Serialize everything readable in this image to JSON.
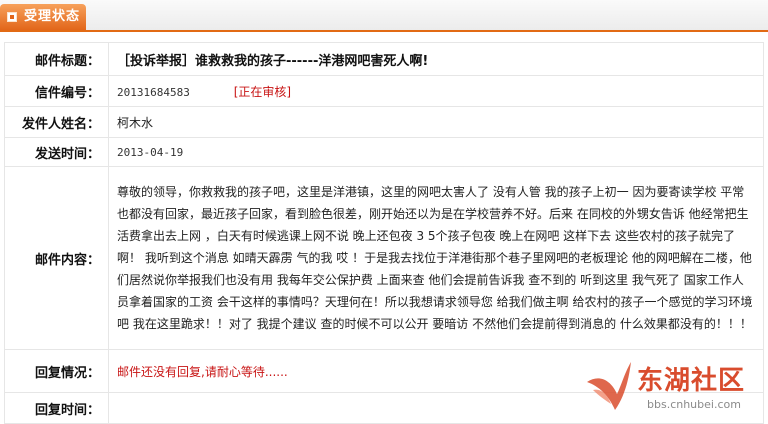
{
  "tab": {
    "label": "受理状态"
  },
  "fields": {
    "title_label": "邮件标题：",
    "title_value": "［投诉举报］谁救救我的孩子------洋港网吧害死人啊!",
    "id_label": "信件编号：",
    "id_value": "20131684583",
    "status": "[正在审核]",
    "sender_label": "发件人姓名：",
    "sender_value": "柯木水",
    "time_label": "发送时间：",
    "time_value": "2013-04-19",
    "content_label": "邮件内容：",
    "content_value": "尊敬的领导，你救救我的孩子吧，这里是洋港镇，这里的网吧太害人了 没有人管 我的孩子上初一 因为要寄读学校 平常也都没有回家，最近孩子回家，看到脸色很差，刚开始还以为是在学校营养不好。后来 在同校的外甥女告诉 他经常把生活费拿出去上网 ，白天有时候逃课上网不说 晚上还包夜 3 5个孩子包夜 晚上在网吧 这样下去 这些农村的孩子就完了啊！ 我听到这个消息 如晴天霹雳 气的我 哎 ！于是我去找位于洋港街那个巷子里网吧的老板理论 他的网吧解在二楼，他们居然说你举报我们也没有用 我每年交公保护费 上面来查 他们会提前告诉我 查不到的 听到这里 我气死了 国家工作人员拿着国家的工资 会干这样的事情吗？天理何在！所以我想请求领导您 给我们做主啊 给农村的孩子一个感觉的学习环境吧 我在这里跪求！！对了 我提个建议 查的时候不可以公开 要暗访 不然他们会提前得到消息的 什么效果都没有的！！！",
    "reply_label": "回复情况：",
    "reply_value": "邮件还没有回复,请耐心等待......",
    "reply_time_label": "回复时间："
  },
  "watermark": {
    "name": "东湖社区",
    "url": "bbs.cnhubei.com"
  },
  "colors": {
    "accent": "#e2661a",
    "status_red": "#c81414",
    "watermark_red": "#d94c2d"
  }
}
